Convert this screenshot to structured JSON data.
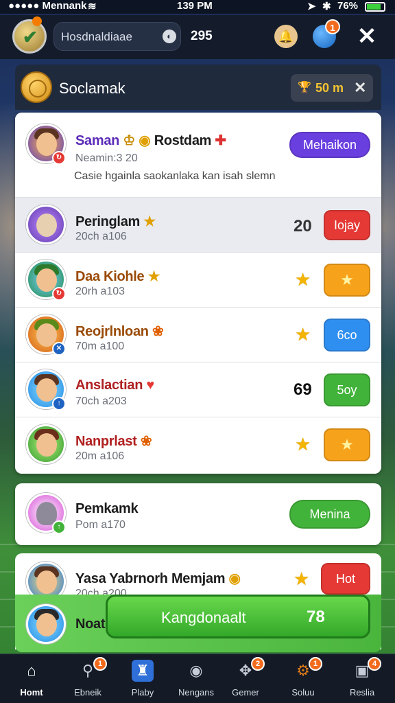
{
  "status_bar": {
    "carrier": "●●●●● Mennank",
    "time": "139 PM",
    "battery": "76%"
  },
  "topbar": {
    "search_text": "Hosdnaldiaae",
    "count": "295",
    "globe_badge": "1"
  },
  "panel": {
    "title": "Soclamak",
    "reward_value": "50 m"
  },
  "rows": [
    {
      "name": "Saman",
      "name_suffix": "Rostdam",
      "sub": "Neamin:3 20",
      "desc": "Casie hgainla saokanlaka kan isah slemn",
      "action": "Mehaikon",
      "name_color": "#5b2bb8"
    },
    {
      "name": "Peringlam",
      "sub": "20ch a106",
      "score": "20",
      "action": "Iojay",
      "name_color": "#1c1c1c"
    },
    {
      "name": "Daa Kiohle",
      "sub": "20rh a103",
      "name_color": "#9a4a06"
    },
    {
      "name": "Reojrlnloan",
      "sub": "70m a100",
      "action": "6co",
      "name_color": "#9a4a06"
    },
    {
      "name": "Anslactian",
      "sub": "70ch a203",
      "score": "69",
      "action": "5oy",
      "name_color": "#b02020"
    },
    {
      "name": "Nanprlast",
      "sub": "20m a106",
      "name_color": "#b02020"
    },
    {
      "name": "Pemkamk",
      "sub": "Pom a170",
      "action": "Menina",
      "name_color": "#1c1c1c"
    },
    {
      "name": "Yasa Yabrnorh Memjam",
      "sub": "20ch a200",
      "action": "Hot",
      "name_color": "#1c1c1c"
    },
    {
      "name": "Noat",
      "name_color": "#1c1c1c"
    }
  ],
  "primary_button": {
    "label": "Kangdonaalt",
    "value": "78"
  },
  "tabs": [
    {
      "label": "Homt",
      "icon": "home-icon"
    },
    {
      "label": "Ebneik",
      "icon": "search-icon",
      "badge": "1"
    },
    {
      "label": "Plaby",
      "icon": "trophy-icon"
    },
    {
      "label": "Nengans",
      "icon": "ball-icon"
    },
    {
      "label": "Gemer",
      "icon": "puzzle-icon",
      "badge": "2"
    },
    {
      "label": "Soluu",
      "icon": "gear-icon",
      "badge": "1"
    },
    {
      "label": "Reslia",
      "icon": "camera-icon",
      "badge": "4"
    }
  ],
  "colors": {
    "purple_button": "#6a3fe0",
    "red_button": "#e53935",
    "orange_button": "#f7a21b",
    "blue_button": "#2f8ff0",
    "green_button": "#42b33a"
  }
}
